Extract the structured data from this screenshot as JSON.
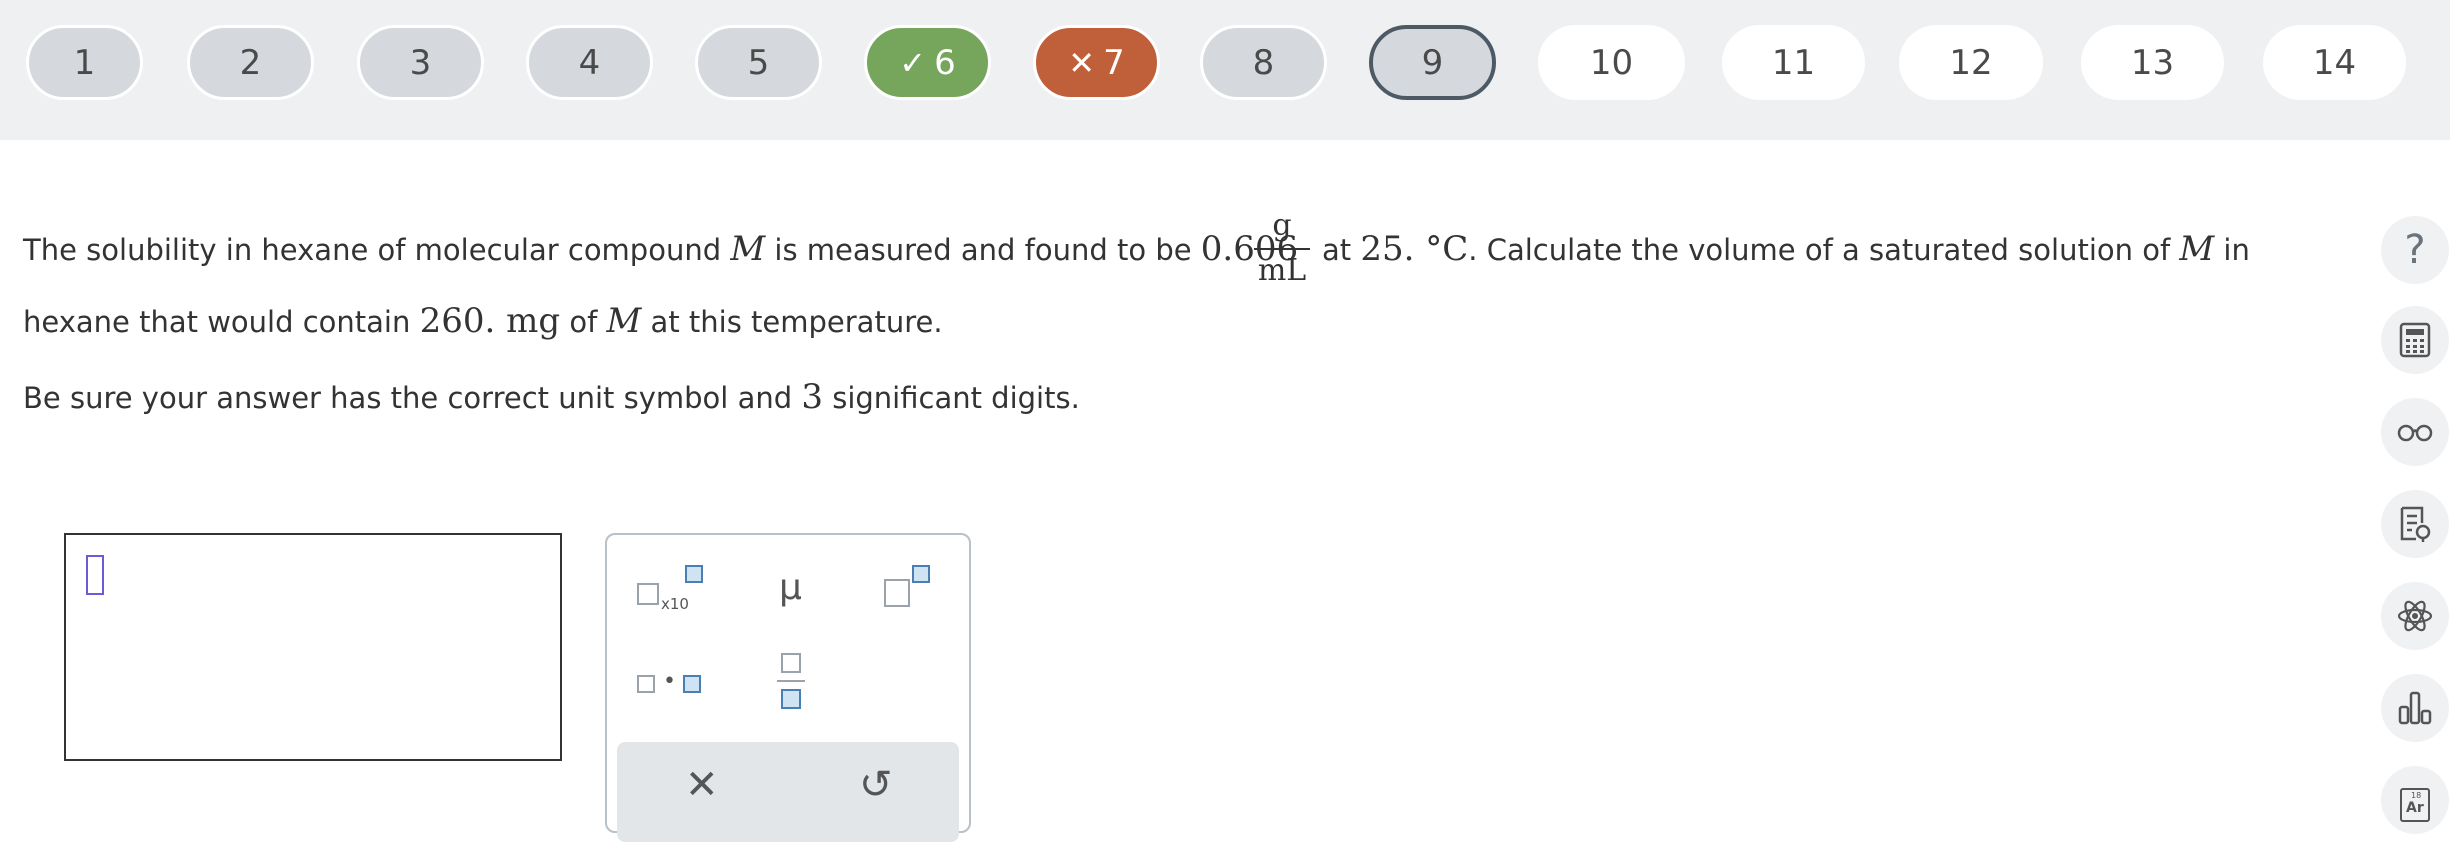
{
  "nav": {
    "questions": [
      {
        "label": "1",
        "state": "visited"
      },
      {
        "label": "2",
        "state": "visited"
      },
      {
        "label": "3",
        "state": "visited"
      },
      {
        "label": "4",
        "state": "visited"
      },
      {
        "label": "5",
        "state": "visited"
      },
      {
        "label": "6",
        "state": "correct",
        "mark": "✓"
      },
      {
        "label": "7",
        "state": "incorrect",
        "mark": "✕"
      },
      {
        "label": "8",
        "state": "visited"
      },
      {
        "label": "9",
        "state": "current"
      },
      {
        "label": "10",
        "state": "unvisited"
      },
      {
        "label": "11",
        "state": "unvisited"
      },
      {
        "label": "12",
        "state": "unvisited"
      },
      {
        "label": "13",
        "state": "unvisited"
      },
      {
        "label": "14",
        "state": "unvisited"
      }
    ]
  },
  "question": {
    "l1_a": "The solubility in hexane of molecular compound ",
    "var": "M",
    "l1_b": " is measured and found to be ",
    "value": "0.606",
    "frac_num": "g",
    "frac_den": "mL",
    "l1_c": " at ",
    "temp": "25. °C",
    "l1_d": ". Calculate the volume of a saturated solution of ",
    "l1_e": " in",
    "l2_a": "hexane that would contain ",
    "mass": "260. mg",
    "l2_b": " of ",
    "l2_c": " at this temperature.",
    "l3_a": "Be sure your answer has the correct unit symbol and ",
    "digits": "3",
    "l3_b": " significant digits."
  },
  "palette": {
    "x10_label": "x10",
    "mu_label": "μ",
    "clear_symbol": "✕",
    "undo_symbol": "↺"
  },
  "tools": [
    "help-icon",
    "calculator-icon",
    "glasses-icon",
    "notes-icon",
    "atom-icon",
    "bar-chart-icon",
    "periodic-table-icon"
  ],
  "periodic": {
    "number": "18",
    "symbol": "Ar"
  },
  "colors": {
    "correct": "#76a55c",
    "incorrect": "#c0603a",
    "current_border": "#4d5a66",
    "caret": "#6b5bd6"
  }
}
